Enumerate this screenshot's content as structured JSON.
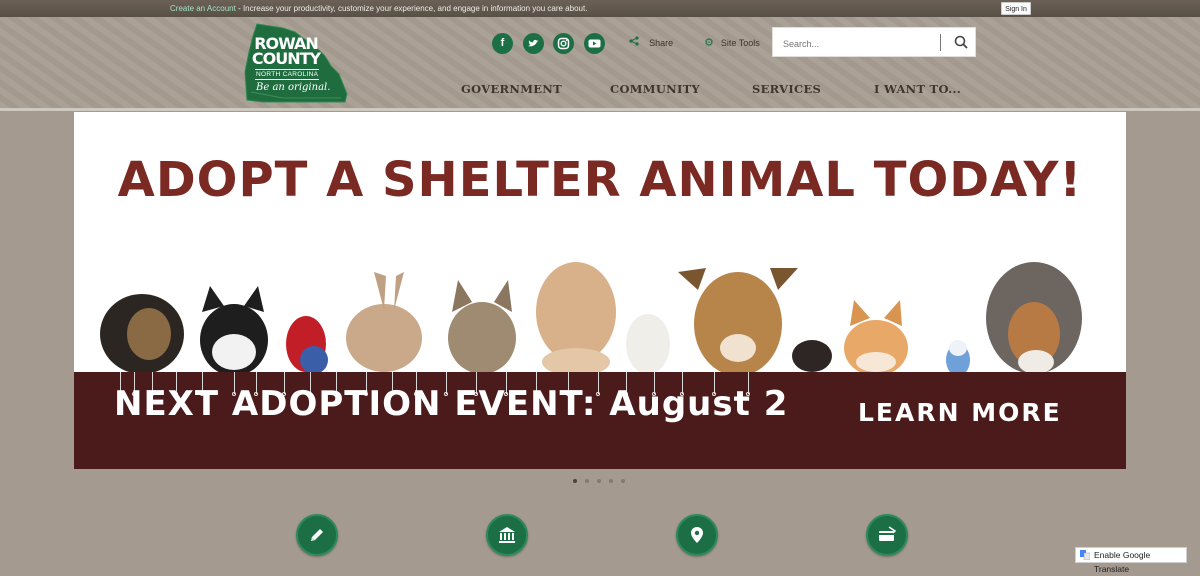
{
  "topbar": {
    "create_account": "Create an Account",
    "tagline": " - Increase your productivity, customize your experience, and engage in information you care about.",
    "sign_in": "Sign In"
  },
  "logo": {
    "line1": "ROWAN",
    "line2": "COUNTY",
    "state": "NORTH CAROLINA",
    "slogan": "Be an original."
  },
  "social": [
    {
      "name": "facebook-icon",
      "glyph": "f"
    },
    {
      "name": "twitter-icon",
      "glyph": "t"
    },
    {
      "name": "instagram-icon",
      "glyph": "◎"
    },
    {
      "name": "youtube-icon",
      "glyph": "▶"
    }
  ],
  "tools": {
    "share": "Share",
    "site_tools": "Site Tools"
  },
  "search": {
    "placeholder": "Search..."
  },
  "nav": {
    "items": [
      "GOVERNMENT",
      "COMMUNITY",
      "SERVICES",
      "I WANT TO..."
    ]
  },
  "hero": {
    "headline": "ADOPT A SHELTER ANIMAL TODAY!",
    "event": "NEXT ADOPTION EVENT: August 2",
    "cta": "LEARN MORE"
  },
  "carousel": {
    "slide_count": 5,
    "active_index": 0
  },
  "quick_links": [
    {
      "icon": "pencil-icon"
    },
    {
      "icon": "government-building-icon"
    },
    {
      "icon": "map-pin-icon"
    },
    {
      "icon": "payment-card-icon"
    }
  ],
  "translate": {
    "label": "Enable Google Translate"
  },
  "colors": {
    "brand_green": "#1c6f45",
    "banner_red": "#7a2a23",
    "event_bar": "#4b1b1b",
    "page_bg": "#a49a8f"
  }
}
